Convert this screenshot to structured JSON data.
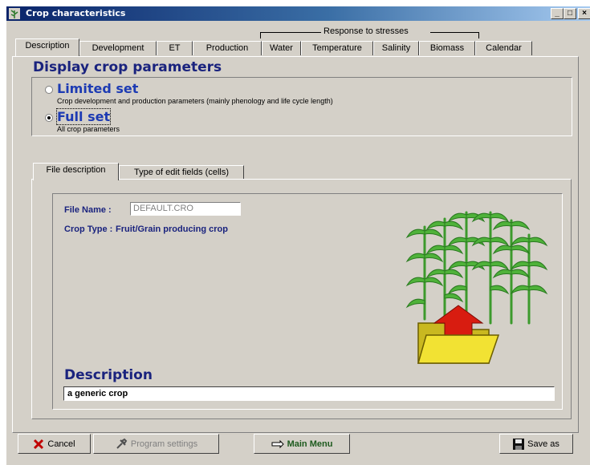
{
  "window": {
    "title": "Crop characteristics",
    "controls": {
      "minimize": "_",
      "maximize": "□",
      "close": "×"
    }
  },
  "stress_group_label": "Response to stresses",
  "tabs": [
    "Description",
    "Development",
    "ET",
    "Production",
    "Water",
    "Temperature",
    "Salinity",
    "Biomass",
    "Calendar"
  ],
  "active_tab": "Description",
  "heading": "Display crop parameters",
  "options": [
    {
      "title": "Limited set",
      "subtitle": "Crop development and production parameters (mainly phenology and life cycle length)",
      "selected": false
    },
    {
      "title": "Full set",
      "subtitle": "All crop parameters",
      "selected": true
    }
  ],
  "subtabs": [
    "File description",
    "Type of edit fields (cells)"
  ],
  "active_subtab": "File description",
  "file": {
    "name_label": "File Name :",
    "name_value": "DEFAULT.CRO",
    "crop_type_label": "Crop Type :",
    "crop_type_value": "Fruit/Grain producing crop"
  },
  "description": {
    "heading": "Description",
    "value": "a generic crop"
  },
  "buttons": {
    "cancel": "Cancel",
    "program_settings": "Program settings",
    "main_menu": "Main Menu",
    "save_as": "Save as"
  },
  "icons": {
    "cancel": "x-icon",
    "program_settings": "settings-icon",
    "main_menu": "hand-pointer-icon",
    "save_as": "floppy-disk-icon",
    "crop_image": "crop-folder-icon"
  },
  "colors": {
    "heading": "#1a237e",
    "option_title": "#1d3bb3",
    "titlebar_start": "#0a246a",
    "plant_green": "#3c9a2c",
    "folder_yellow": "#f2e233",
    "arrow_red": "#d81c10"
  }
}
